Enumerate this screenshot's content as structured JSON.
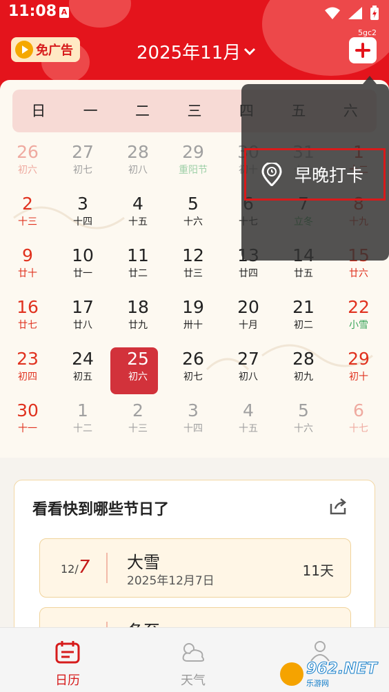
{
  "status_bar": {
    "time": "11:08",
    "notif": "A"
  },
  "header": {
    "no_ad_label": "免广告",
    "month_label": "2025年11月",
    "device_code": "5gc2"
  },
  "weekdays": [
    "日",
    "一",
    "二",
    "三",
    "四",
    "五",
    "六"
  ],
  "weeks": [
    [
      {
        "d": "26",
        "l": "初六",
        "c": "pink",
        "lc": "pink"
      },
      {
        "d": "27",
        "l": "初七",
        "c": "gry",
        "lc": "gry"
      },
      {
        "d": "28",
        "l": "初八",
        "c": "gry",
        "lc": "gry"
      },
      {
        "d": "29",
        "l": "重阳节",
        "c": "gry",
        "lc": "lgrn"
      },
      {
        "d": "30",
        "l": "初十",
        "c": "gry",
        "lc": "gry"
      },
      {
        "d": "31",
        "l": "十一",
        "c": "gry",
        "lc": "gry"
      },
      {
        "d": "1",
        "l": "十二",
        "c": "red",
        "lc": "red"
      }
    ],
    [
      {
        "d": "2",
        "l": "十三",
        "c": "red",
        "lc": "red"
      },
      {
        "d": "3",
        "l": "十四",
        "c": "blk",
        "lc": "blk"
      },
      {
        "d": "4",
        "l": "十五",
        "c": "blk",
        "lc": "blk"
      },
      {
        "d": "5",
        "l": "十六",
        "c": "blk",
        "lc": "blk"
      },
      {
        "d": "6",
        "l": "十七",
        "c": "blk",
        "lc": "blk"
      },
      {
        "d": "7",
        "l": "立冬",
        "c": "blk",
        "lc": "grn"
      },
      {
        "d": "8",
        "l": "十九",
        "c": "red",
        "lc": "red"
      }
    ],
    [
      {
        "d": "9",
        "l": "廿十",
        "c": "red",
        "lc": "red"
      },
      {
        "d": "10",
        "l": "廿一",
        "c": "blk",
        "lc": "blk"
      },
      {
        "d": "11",
        "l": "廿二",
        "c": "blk",
        "lc": "blk"
      },
      {
        "d": "12",
        "l": "廿三",
        "c": "blk",
        "lc": "blk"
      },
      {
        "d": "13",
        "l": "廿四",
        "c": "blk",
        "lc": "blk"
      },
      {
        "d": "14",
        "l": "廿五",
        "c": "blk",
        "lc": "blk"
      },
      {
        "d": "15",
        "l": "廿六",
        "c": "red",
        "lc": "red"
      }
    ],
    [
      {
        "d": "16",
        "l": "廿七",
        "c": "red",
        "lc": "red"
      },
      {
        "d": "17",
        "l": "廿八",
        "c": "blk",
        "lc": "blk"
      },
      {
        "d": "18",
        "l": "廿九",
        "c": "blk",
        "lc": "blk"
      },
      {
        "d": "19",
        "l": "卅十",
        "c": "blk",
        "lc": "blk"
      },
      {
        "d": "20",
        "l": "十月",
        "c": "blk",
        "lc": "blk"
      },
      {
        "d": "21",
        "l": "初二",
        "c": "blk",
        "lc": "blk"
      },
      {
        "d": "22",
        "l": "小雪",
        "c": "red",
        "lc": "grn"
      }
    ],
    [
      {
        "d": "23",
        "l": "初四",
        "c": "red",
        "lc": "red"
      },
      {
        "d": "24",
        "l": "初五",
        "c": "blk",
        "lc": "blk"
      },
      {
        "d": "25",
        "l": "初六",
        "c": "sel",
        "lc": "sel"
      },
      {
        "d": "26",
        "l": "初七",
        "c": "blk",
        "lc": "blk"
      },
      {
        "d": "27",
        "l": "初八",
        "c": "blk",
        "lc": "blk"
      },
      {
        "d": "28",
        "l": "初九",
        "c": "blk",
        "lc": "blk"
      },
      {
        "d": "29",
        "l": "初十",
        "c": "red",
        "lc": "red"
      }
    ],
    [
      {
        "d": "30",
        "l": "十一",
        "c": "red",
        "lc": "red"
      },
      {
        "d": "1",
        "l": "十二",
        "c": "gry",
        "lc": "gry"
      },
      {
        "d": "2",
        "l": "十三",
        "c": "gry",
        "lc": "gry"
      },
      {
        "d": "3",
        "l": "十四",
        "c": "gry",
        "lc": "gry"
      },
      {
        "d": "4",
        "l": "十五",
        "c": "gry",
        "lc": "gry"
      },
      {
        "d": "5",
        "l": "十六",
        "c": "gry",
        "lc": "gry"
      },
      {
        "d": "6",
        "l": "十七",
        "c": "pink",
        "lc": "pink"
      }
    ]
  ],
  "popup": {
    "checkin_label": "早晚打卡"
  },
  "festivals": {
    "title": "看看快到哪些节日了",
    "items": [
      {
        "month": "12/",
        "day": "7",
        "name": "大雪",
        "full_date": "2025年12月7日",
        "days": "11天"
      },
      {
        "month": "",
        "day": "",
        "name": "冬至",
        "full_date": "",
        "days": ""
      }
    ]
  },
  "tabs": {
    "calendar": "日历",
    "weather": "天气"
  },
  "watermark": {
    "brand": "962.NET",
    "sub": "乐游网"
  },
  "colors": {
    "brand_red": "#e4141c",
    "selected_day": "#d2323b",
    "holiday_red": "#e0321f",
    "solar_term_green": "#3aa55a"
  }
}
